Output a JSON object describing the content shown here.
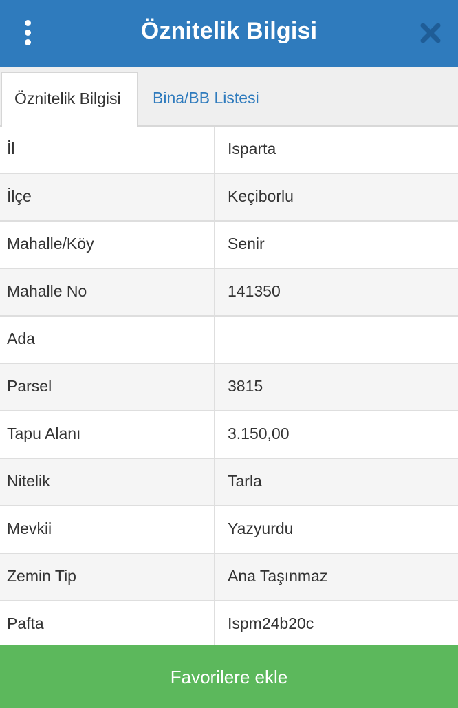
{
  "header": {
    "title": "Öznitelik Bilgisi",
    "menu_icon": "more-vertical-icon",
    "close_icon": "close-icon",
    "background_color": "#2f7bbd"
  },
  "tabs": [
    {
      "label": "Öznitelik Bilgisi",
      "active": true
    },
    {
      "label": "Bina/BB Listesi",
      "active": false
    }
  ],
  "attributes": [
    {
      "key": "İl",
      "value": "Isparta"
    },
    {
      "key": "İlçe",
      "value": "Keçiborlu"
    },
    {
      "key": "Mahalle/Köy",
      "value": "Senir"
    },
    {
      "key": "Mahalle No",
      "value": "141350"
    },
    {
      "key": "Ada",
      "value": ""
    },
    {
      "key": "Parsel",
      "value": "3815"
    },
    {
      "key": "Tapu Alanı",
      "value": "3.150,00"
    },
    {
      "key": "Nitelik",
      "value": "Tarla"
    },
    {
      "key": "Mevkii",
      "value": "Yazyurdu"
    },
    {
      "key": "Zemin Tip",
      "value": "Ana Taşınmaz"
    },
    {
      "key": "Pafta",
      "value": "Ispm24b20c"
    }
  ],
  "footer": {
    "favorite_button_label": "Favorilere ekle",
    "button_color": "#5cb85c"
  }
}
